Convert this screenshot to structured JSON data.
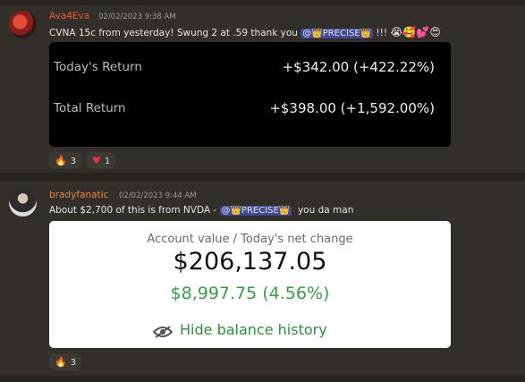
{
  "messages": [
    {
      "username": "Ava4Eva",
      "timestamp": "02/02/2023 9:38 AM",
      "text_before": "CVNA 15c from yesterday! Swung 2 at .59 thank you ",
      "mention": "@👑PRECISE👑",
      "text_after": " !!!",
      "emojis": [
        "😭",
        "🥰",
        "💕",
        "😍"
      ],
      "card": {
        "rows": [
          {
            "label": "Today's Return",
            "value": "+$342.00 (+422.22%)"
          },
          {
            "label": "Total Return",
            "value": "+$398.00 (+1,592.00%)"
          }
        ]
      },
      "reactions": [
        {
          "icon": "fire",
          "count": "3"
        },
        {
          "icon": "heart",
          "count": "1"
        }
      ]
    },
    {
      "username": "bradyfanatic",
      "timestamp": "02/02/2023 9:44 AM",
      "text_before": "About $2,700 of this is from NVDA - ",
      "mention": "@👑PRECISE👑",
      "text_after": "  you da man",
      "card": {
        "header": "Account value / Today's net change",
        "value": "$206,137.05",
        "change": "$8,997.75 (4.56%)",
        "action": "Hide balance history"
      },
      "reactions": [
        {
          "icon": "fire",
          "count": "3"
        }
      ]
    }
  ],
  "colors": {
    "username1": "#e65a3f",
    "username2": "#e8873d",
    "mention_bg": "#444a8f",
    "gain_green": "#3b9d4a"
  }
}
